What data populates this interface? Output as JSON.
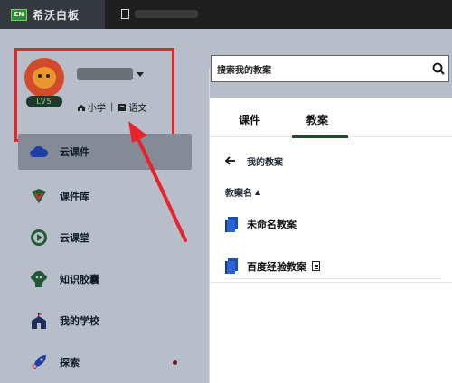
{
  "titlebar": {
    "tab_logo": "EN",
    "tab_title": "希沃白板"
  },
  "profile": {
    "level": "LV5",
    "grade": "小学",
    "subject": "语文"
  },
  "sidebar": {
    "items": [
      {
        "label": "云课件",
        "icon": "cloud-icon",
        "active": true
      },
      {
        "label": "课件库",
        "icon": "courseware-library-icon"
      },
      {
        "label": "云课堂",
        "icon": "play-icon"
      },
      {
        "label": "知识胶囊",
        "icon": "capsule-icon"
      },
      {
        "label": "我的学校",
        "icon": "school-icon"
      },
      {
        "label": "探索",
        "icon": "rocket-icon",
        "badge_dot": true
      }
    ]
  },
  "search": {
    "placeholder": "搜索我的教案"
  },
  "tabs": [
    {
      "label": "课件"
    },
    {
      "label": "教案",
      "active": true
    }
  ],
  "breadcrumb": {
    "label": "我的教案"
  },
  "table": {
    "column_name": "教案名",
    "rows": [
      {
        "name": "未命名教案",
        "has_attachment": false
      },
      {
        "name": "百度经验教案",
        "has_attachment": true
      }
    ]
  },
  "colors": {
    "annotation_red": "#e8232b",
    "active_tab_underline": "#1e4d2b",
    "file_icon_blue": "#1e4fb8"
  }
}
